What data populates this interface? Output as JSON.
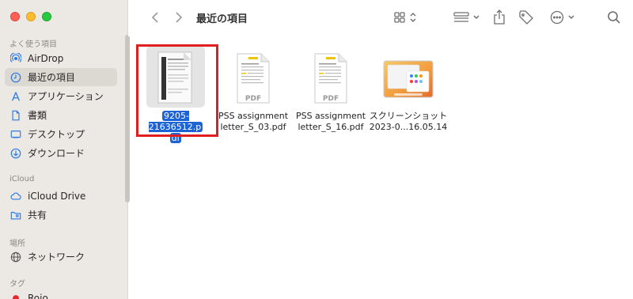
{
  "window": {
    "title": "最近の項目"
  },
  "sidebar": {
    "sections": [
      {
        "title": "よく使う項目",
        "items": [
          {
            "label": "AirDrop",
            "icon": "airdrop-icon"
          },
          {
            "label": "最近の項目",
            "icon": "clock-icon",
            "active": true
          },
          {
            "label": "アプリケーション",
            "icon": "applications-icon"
          },
          {
            "label": "書類",
            "icon": "document-icon"
          },
          {
            "label": "デスクトップ",
            "icon": "desktop-icon"
          },
          {
            "label": "ダウンロード",
            "icon": "download-icon"
          }
        ]
      },
      {
        "title": "iCloud",
        "items": [
          {
            "label": "iCloud Drive",
            "icon": "cloud-icon"
          },
          {
            "label": "共有",
            "icon": "shared-folder-icon"
          }
        ]
      },
      {
        "title": "場所",
        "items": [
          {
            "label": "ネットワーク",
            "icon": "network-icon"
          }
        ]
      },
      {
        "title": "タグ",
        "items": [
          {
            "label": "Rojo",
            "icon": "tag-red-dot"
          }
        ]
      }
    ]
  },
  "files": [
    {
      "name_line1": "9205-21636512.p",
      "name_line2": "df",
      "selected": true
    },
    {
      "name_line1": "PSS assignment",
      "name_line2": "letter_S_03.pdf",
      "badge": "PDF"
    },
    {
      "name_line1": "PSS assignment",
      "name_line2": "letter_S_16.pdf",
      "badge": "PDF"
    },
    {
      "name_line1": "スクリーンショット",
      "name_line2": "2023-0...16.05.14"
    }
  ],
  "colors": {
    "selection": "#1c63d6",
    "highlight_box": "#e02020",
    "accent": "#2c7be5"
  }
}
